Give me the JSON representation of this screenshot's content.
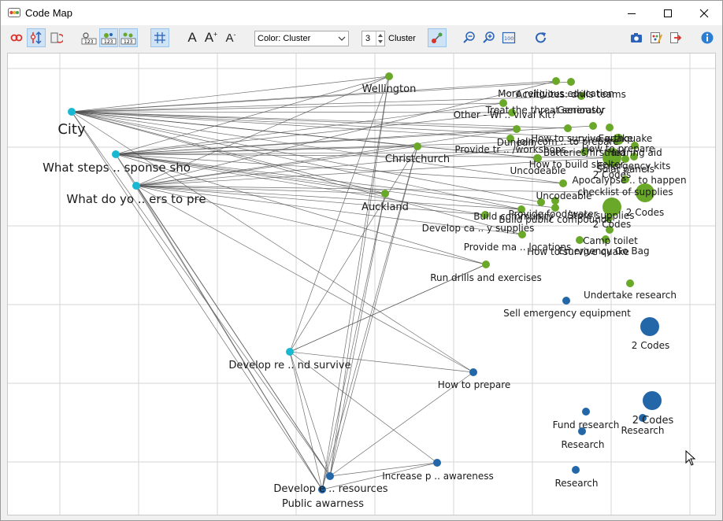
{
  "window": {
    "title": "Code Map"
  },
  "toolbar": {
    "color_mode": "Color: Cluster",
    "cluster_count": "3",
    "cluster_label": "Cluster",
    "font_large": "A",
    "font_increase": "A",
    "font_decrease": "A",
    "zoom_reset": "100"
  },
  "colors": {
    "cyan": "#19b8d2",
    "green": "#6aa82a",
    "blue": "#2367a8",
    "edge": "#555555",
    "grid": "#d6d6d6"
  },
  "icons": [
    "link-icon",
    "filter-icon",
    "refresh-link-icon",
    "label-123-icon",
    "cluster-123-icon",
    "cluster-123-alt-icon",
    "grid-icon",
    "font-size-icon",
    "zoom-out-icon",
    "zoom-in-icon",
    "zoom-100-icon",
    "redo-icon",
    "camera-icon",
    "palette-icon",
    "export-icon",
    "info-icon"
  ],
  "nodes": [
    {
      "label": "City",
      "color": "cyan",
      "size": 10
    },
    {
      "label": "What steps .. sponse sho",
      "color": "cyan",
      "size": 10
    },
    {
      "label": "What do yo .. ers to pre",
      "color": "cyan",
      "size": 10
    },
    {
      "label": "Develop re .. nd survive",
      "color": "cyan",
      "size": 10
    },
    {
      "label": "Wellington",
      "color": "green",
      "size": 10
    },
    {
      "label": "Christchurch",
      "color": "green",
      "size": 10
    },
    {
      "label": "Auckland",
      "color": "green",
      "size": 10
    },
    {
      "label": "Run drills and exercises",
      "color": "green",
      "size": 10
    },
    {
      "label": "More religious education",
      "color": "green",
      "size": 10
    },
    {
      "label": "Acvitivites: drills teams",
      "color": "green",
      "size": 10
    },
    {
      "label": "Treat the threat seriously",
      "color": "green",
      "size": 10
    },
    {
      "label": "Generator",
      "color": "green",
      "size": 10
    },
    {
      "label": "Other - Wi .. vival Kit?",
      "color": "green",
      "size": 10
    },
    {
      "label": "Dunedin",
      "color": "green",
      "size": 10
    },
    {
      "label": "Join com .. to prepare",
      "color": "green",
      "size": 10
    },
    {
      "label": "How to survive quake",
      "color": "green",
      "size": 10
    },
    {
      "label": "Earthquake",
      "color": "green",
      "size": 10
    },
    {
      "label": "How to prepare",
      "color": "green",
      "size": 10
    },
    {
      "label": "Provide tr .. /workshops",
      "color": "green",
      "size": 10
    },
    {
      "label": "Batteries/first aid",
      "color": "green",
      "size": 10
    },
    {
      "label": "Hearing aid",
      "color": "green",
      "size": 10
    },
    {
      "label": "How to build shelter",
      "color": "green",
      "size": 10
    },
    {
      "label": "Emergency kits",
      "color": "green",
      "size": 10
    },
    {
      "label": "Uncodeable",
      "color": "green",
      "size": 10
    },
    {
      "label": "2 Codes",
      "color": "green",
      "size": 10
    },
    {
      "label": "Solar panels",
      "color": "green",
      "size": 10
    },
    {
      "label": "Apocalypse .. to happen",
      "color": "green",
      "size": 10
    },
    {
      "label": "checklist of supplies",
      "color": "green",
      "size": 10
    },
    {
      "label": "Uncodeable",
      "color": "green",
      "size": 10
    },
    {
      "label": "2 Codes",
      "color": "green",
      "size": 10
    },
    {
      "label": "Provide food/water",
      "color": "green",
      "size": 10
    },
    {
      "label": "Build community",
      "color": "green",
      "size": 10
    },
    {
      "label": "Build public compounds",
      "color": "green",
      "size": 10
    },
    {
      "label": "Store supplies",
      "color": "green",
      "size": 10
    },
    {
      "label": "2 Codes",
      "color": "green",
      "size": 10
    },
    {
      "label": "Develop ca .. y supplies",
      "color": "green",
      "size": 10
    },
    {
      "label": "Provide ma .. locations",
      "color": "green",
      "size": 10
    },
    {
      "label": "Camp toilet",
      "color": "green",
      "size": 10
    },
    {
      "label": "How to survive quake",
      "color": "green",
      "size": 10
    },
    {
      "label": "Emergency Go Bag",
      "color": "green",
      "size": 10
    },
    {
      "label": "Undertake research",
      "color": "green",
      "size": 10
    },
    {
      "label": "Sell emergency equipment",
      "color": "blue",
      "size": 10
    },
    {
      "label": "2 Codes",
      "color": "blue",
      "size": 10
    },
    {
      "label": "How to prepare",
      "color": "blue",
      "size": 10
    },
    {
      "label": "2 Codes",
      "color": "blue",
      "size": 10
    },
    {
      "label": "Research",
      "color": "blue",
      "size": 10
    },
    {
      "label": "Fund research",
      "color": "blue",
      "size": 10
    },
    {
      "label": "Research",
      "color": "blue",
      "size": 10
    },
    {
      "label": "Research",
      "color": "blue",
      "size": 10
    },
    {
      "label": "Increase p .. awareness",
      "color": "blue",
      "size": 10
    },
    {
      "label": "Develop e .. resources",
      "color": "blue",
      "size": 10
    },
    {
      "label": "Public awarness",
      "color": "blue",
      "size": 10
    }
  ]
}
